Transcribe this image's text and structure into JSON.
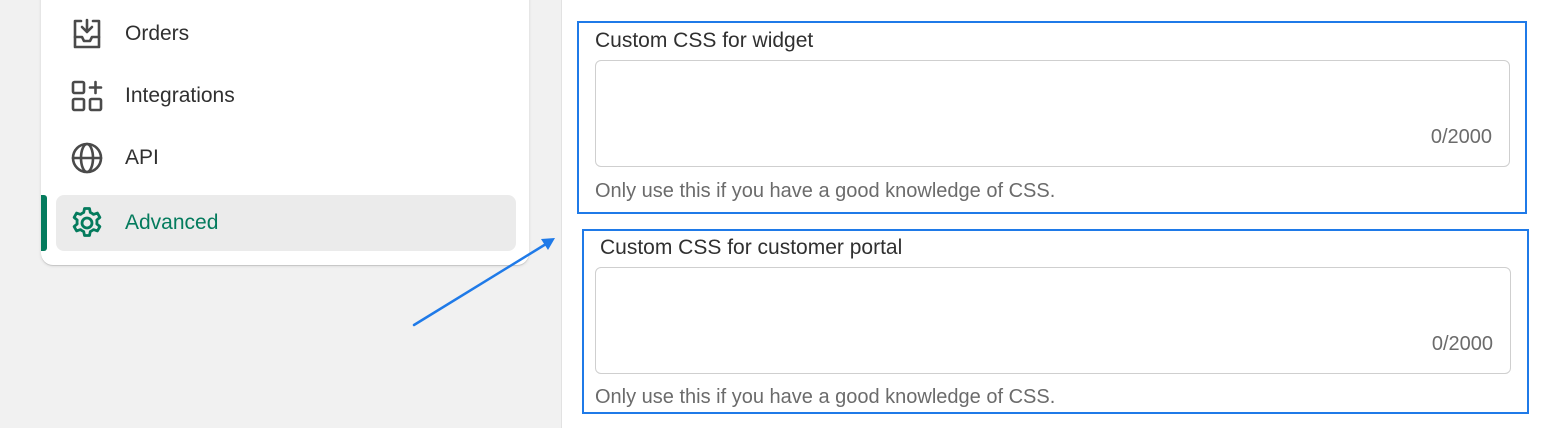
{
  "sidebar": {
    "items": [
      {
        "label": "Orders",
        "icon": "orders-inbox-icon",
        "active": false
      },
      {
        "label": "Integrations",
        "icon": "integrations-apps-icon",
        "active": false
      },
      {
        "label": "API",
        "icon": "globe-icon",
        "active": false
      },
      {
        "label": "Advanced",
        "icon": "gear-icon",
        "active": true
      }
    ]
  },
  "main": {
    "fields": [
      {
        "label": "Custom CSS for widget",
        "value": "",
        "counter": "0/2000",
        "help": "Only use this if you have a good knowledge of CSS."
      },
      {
        "label": "Custom CSS for customer portal",
        "value": "",
        "counter": "0/2000",
        "help": "Only use this if you have a good knowledge of CSS."
      }
    ]
  },
  "colors": {
    "accent_green": "#047b5d",
    "highlight_blue": "#1f7ae8",
    "page_bg": "#f1f1f1"
  }
}
